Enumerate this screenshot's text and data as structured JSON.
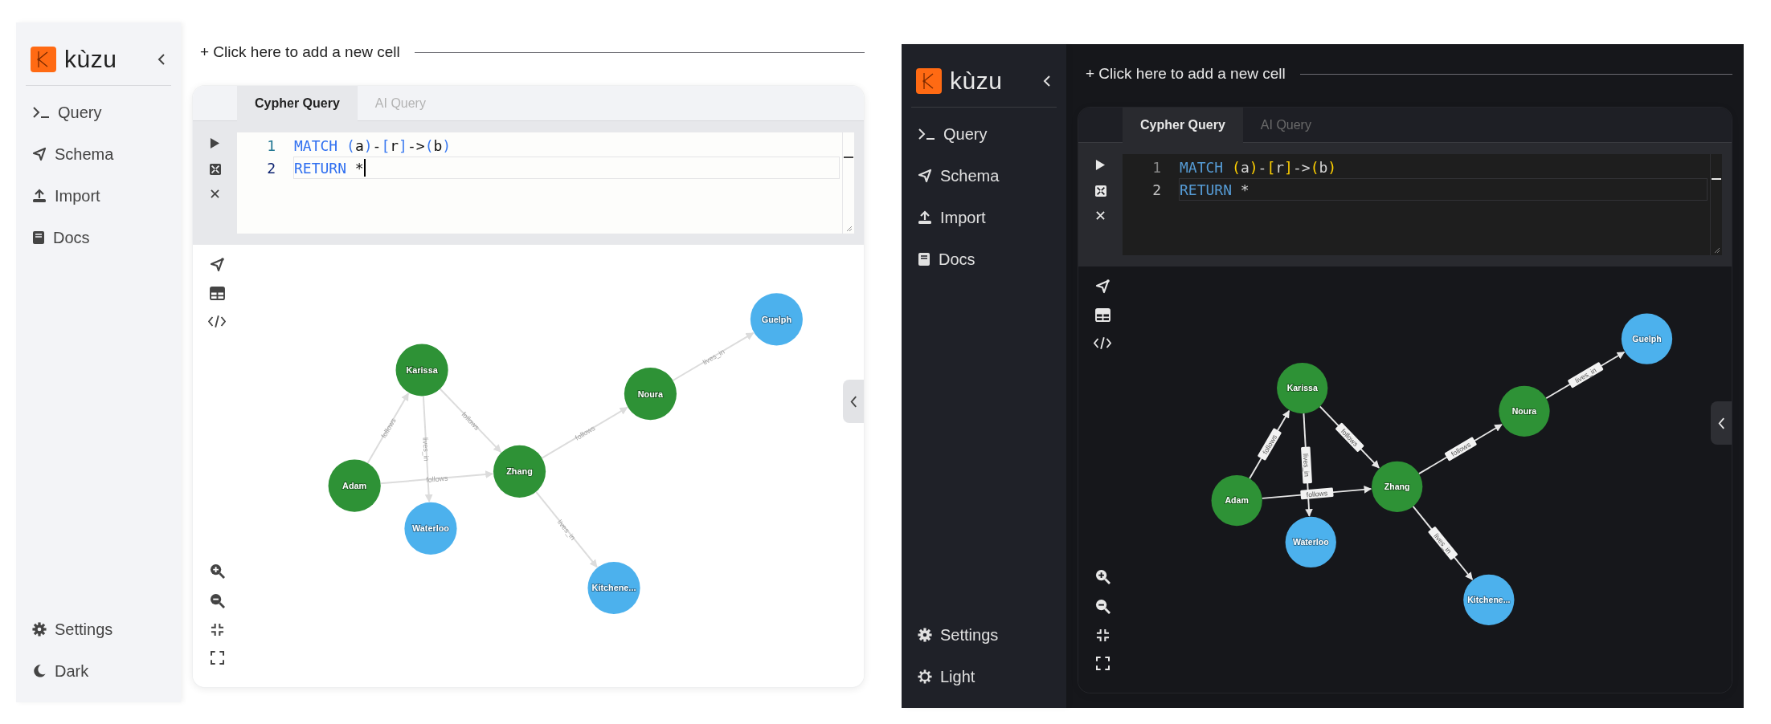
{
  "panels": [
    {
      "kind": "light",
      "logo": {
        "text": "kùzu"
      },
      "nav": [
        {
          "label": "Query"
        },
        {
          "label": "Schema"
        },
        {
          "label": "Import"
        },
        {
          "label": "Docs"
        }
      ],
      "footer": [
        {
          "label": "Settings"
        },
        {
          "label": "Dark"
        }
      ],
      "add_cell": "+ Click here to add a new cell",
      "tabs": [
        {
          "label": "Cypher Query",
          "selected": true
        },
        {
          "label": "AI Query",
          "selected": false
        }
      ],
      "code": [
        {
          "number": "1",
          "active": false,
          "cursor": false,
          "tokens": [
            {
              "text": "MATCH ",
              "kind": "keyword"
            },
            {
              "text": "(",
              "kind": "bracket"
            },
            {
              "text": "a",
              "kind": "plain"
            },
            {
              "text": ")",
              "kind": "bracket"
            },
            {
              "text": "-",
              "kind": "plain"
            },
            {
              "text": "[",
              "kind": "bracket"
            },
            {
              "text": "r",
              "kind": "plain"
            },
            {
              "text": "]",
              "kind": "bracket"
            },
            {
              "text": "->",
              "kind": "plain"
            },
            {
              "text": "(",
              "kind": "bracket"
            },
            {
              "text": "b",
              "kind": "plain"
            },
            {
              "text": ")",
              "kind": "bracket"
            }
          ]
        },
        {
          "number": "2",
          "active": true,
          "cursor": true,
          "tokens": [
            {
              "text": "RETURN",
              "kind": "keyword"
            },
            {
              "text": " *",
              "kind": "plain"
            }
          ]
        }
      ],
      "graph": {
        "nodes": [
          {
            "label": "Karissa",
            "color": "#2e9236"
          },
          {
            "label": "Adam",
            "color": "#2e9236"
          },
          {
            "label": "Waterloo",
            "color": "#4cb1ed"
          },
          {
            "label": "Zhang",
            "color": "#2e9236"
          },
          {
            "label": "Noura",
            "color": "#2e9236"
          },
          {
            "label": "Guelph",
            "color": "#4cb1ed"
          },
          {
            "label": "Kitchene...",
            "color": "#4cb1ed"
          }
        ],
        "edges": [
          {
            "label": "follows"
          },
          {
            "label": "lives_in"
          },
          {
            "label": "follows"
          },
          {
            "label": "follows"
          },
          {
            "label": "follows"
          },
          {
            "label": "lives_in"
          },
          {
            "label": "lives_in"
          }
        ]
      }
    },
    {
      "kind": "dark",
      "logo": {
        "text": "kùzu"
      },
      "nav": [
        {
          "label": "Query"
        },
        {
          "label": "Schema"
        },
        {
          "label": "Import"
        },
        {
          "label": "Docs"
        }
      ],
      "footer": [
        {
          "label": "Settings"
        },
        {
          "label": "Light"
        }
      ],
      "add_cell": "+ Click here to add a new cell",
      "tabs": [
        {
          "label": "Cypher Query",
          "selected": true
        },
        {
          "label": "AI Query",
          "selected": false
        }
      ],
      "code": [
        {
          "number": "1",
          "active": false,
          "cursor": false,
          "tokens": [
            {
              "text": "MATCH ",
              "kind": "keyword"
            },
            {
              "text": "(",
              "kind": "bracket"
            },
            {
              "text": "a",
              "kind": "plain"
            },
            {
              "text": ")",
              "kind": "bracket"
            },
            {
              "text": "-",
              "kind": "plain"
            },
            {
              "text": "[",
              "kind": "bracket"
            },
            {
              "text": "r",
              "kind": "plain"
            },
            {
              "text": "]",
              "kind": "bracket"
            },
            {
              "text": "->",
              "kind": "plain"
            },
            {
              "text": "(",
              "kind": "bracket"
            },
            {
              "text": "b",
              "kind": "plain"
            },
            {
              "text": ")",
              "kind": "bracket"
            }
          ]
        },
        {
          "number": "2",
          "active": true,
          "cursor": false,
          "tokens": [
            {
              "text": "RETURN",
              "kind": "keyword"
            },
            {
              "text": " *",
              "kind": "plain"
            }
          ]
        }
      ],
      "graph": {
        "nodes": [
          {
            "label": "Karissa",
            "color": "#2e9236"
          },
          {
            "label": "Adam",
            "color": "#2e9236"
          },
          {
            "label": "Waterloo",
            "color": "#4cb1ed"
          },
          {
            "label": "Zhang",
            "color": "#2e9236"
          },
          {
            "label": "Noura",
            "color": "#2e9236"
          },
          {
            "label": "Guelph",
            "color": "#4cb1ed"
          },
          {
            "label": "Kitchene...",
            "color": "#4cb1ed"
          }
        ],
        "edges": [
          {
            "label": "follows"
          },
          {
            "label": "lives_in"
          },
          {
            "label": "follows"
          },
          {
            "label": "follows"
          },
          {
            "label": "follows"
          },
          {
            "label": "lives_in"
          },
          {
            "label": "lives_in"
          }
        ]
      }
    }
  ]
}
